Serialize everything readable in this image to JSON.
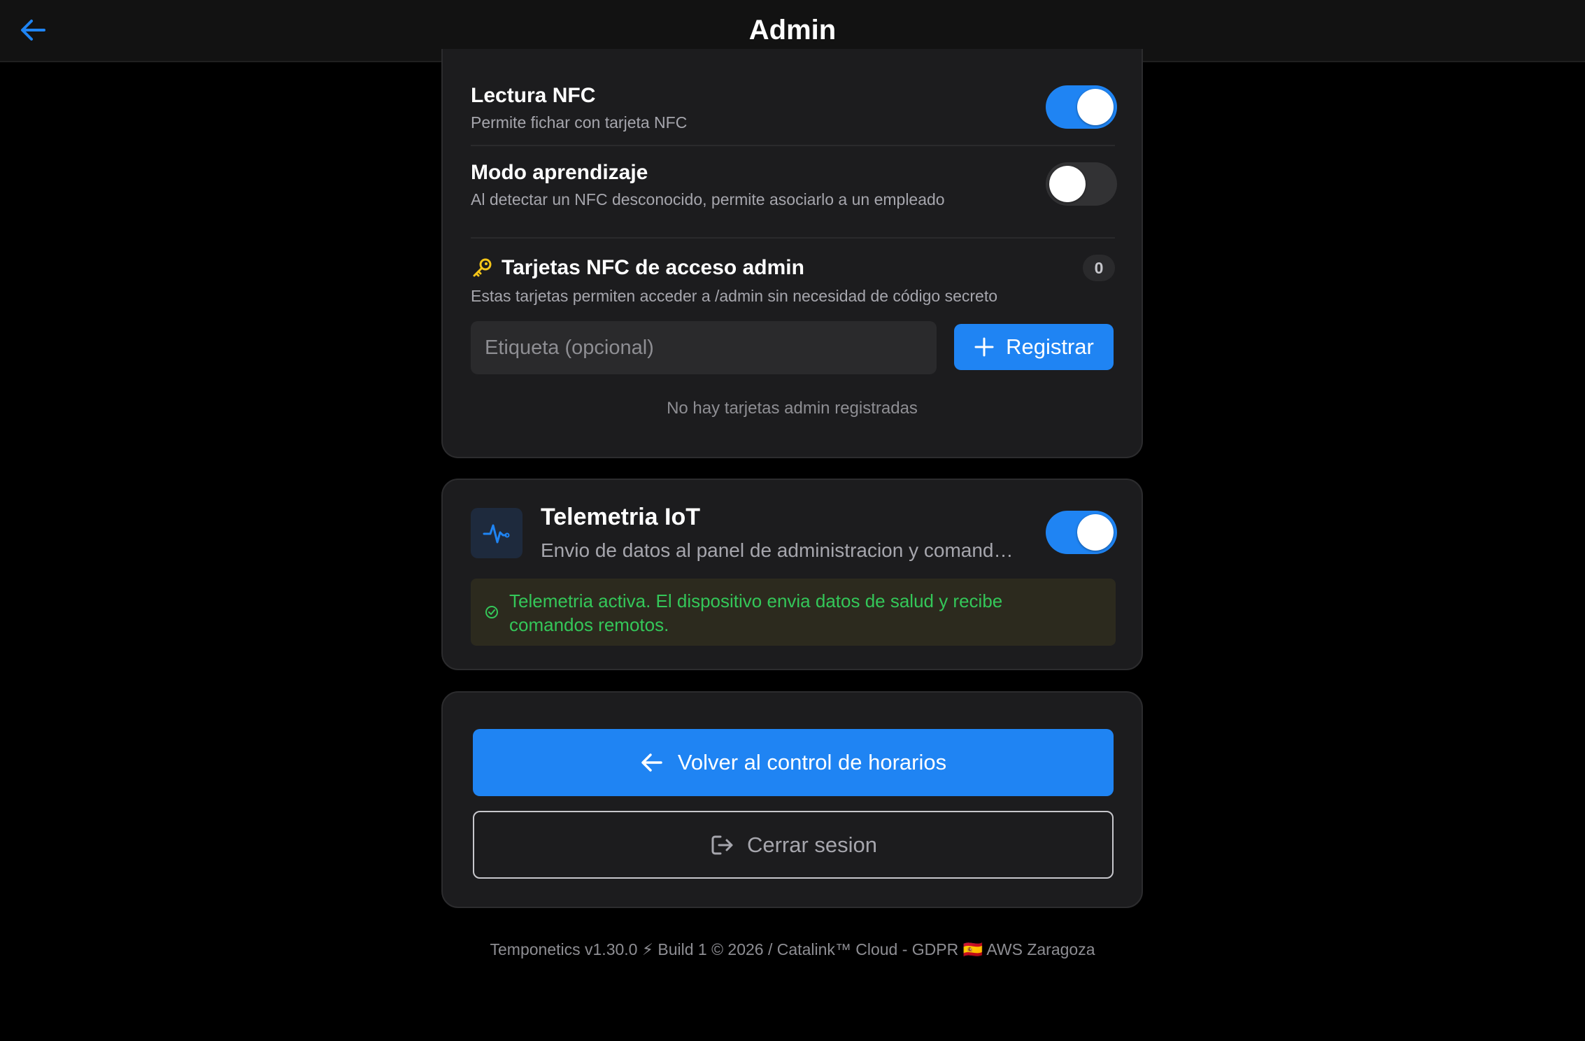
{
  "header": {
    "title": "Admin",
    "back_icon": "arrow-left-icon"
  },
  "nfc_card": {
    "nfc_reading": {
      "title": "Lectura NFC",
      "subtitle": "Permite fichar con tarjeta NFC",
      "enabled": true
    },
    "learning_mode": {
      "title": "Modo aprendizaje",
      "subtitle": "Al detectar un NFC desconocido, permite asociarlo a un empleado",
      "enabled": false
    },
    "admin_cards": {
      "icon": "key-icon",
      "title": "Tarjetas NFC de acceso admin",
      "count": "0",
      "subtitle": "Estas tarjetas permiten acceder a /admin sin necesidad de código secreto",
      "input_placeholder": "Etiqueta (opcional)",
      "input_value": "",
      "register_label": "Registrar",
      "empty_message": "No hay tarjetas admin registradas"
    }
  },
  "iot_card": {
    "icon": "heartbeat-icon",
    "title": "Telemetria IoT",
    "subtitle": "Envio de datos al panel de administracion y comandos remotos",
    "enabled": true,
    "status_message": "Telemetria activa. El dispositivo envia datos de salud y recibe comandos remotos."
  },
  "actions": {
    "back_label": "Volver al control de horarios",
    "logout_label": "Cerrar sesion"
  },
  "footer": {
    "text": "Temponetics v1.30.0 ⚡ Build 1 © 2026 / Catalink™ Cloud - GDPR 🇪🇸 AWS Zaragoza"
  },
  "colors": {
    "accent": "#1f84f3",
    "success": "#34c759",
    "background": "#000000",
    "card": "#1c1c1e"
  }
}
